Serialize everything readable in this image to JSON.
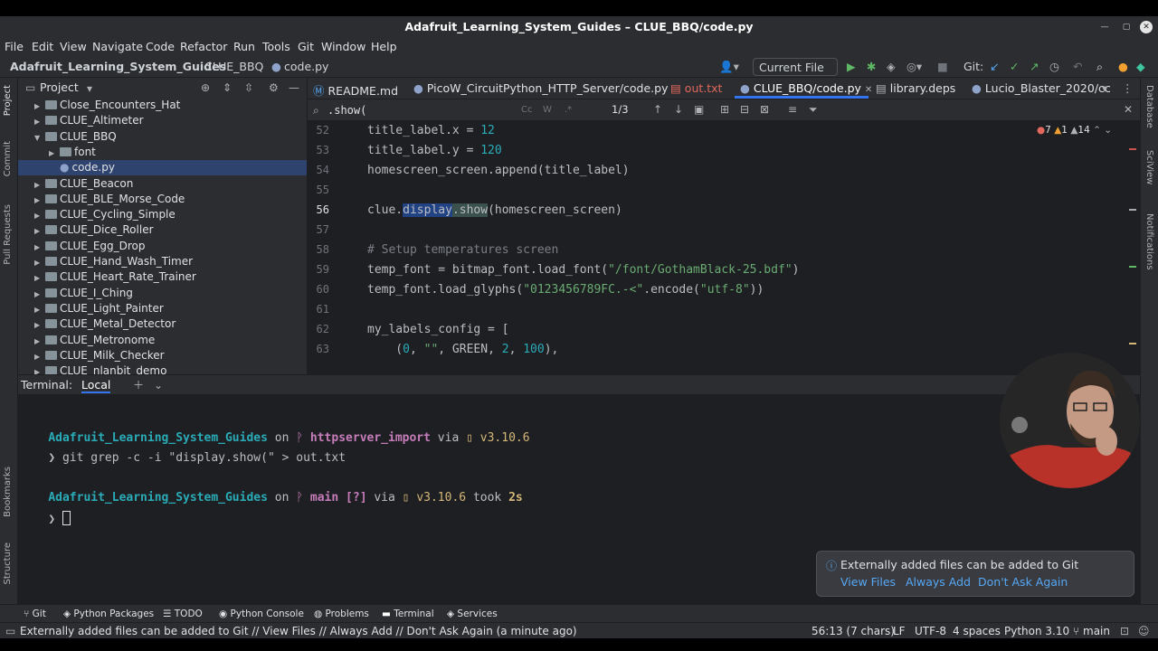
{
  "window": {
    "title": "Adafruit_Learning_System_Guides – CLUE_BBQ/code.py"
  },
  "menu": [
    "File",
    "Edit",
    "View",
    "Navigate",
    "Code",
    "Refactor",
    "Run",
    "Tools",
    "Git",
    "Window",
    "Help"
  ],
  "breadcrumb": [
    "Adafruit_Learning_System_Guides",
    "CLUE_BBQ",
    "code.py"
  ],
  "run_config": "Current File",
  "git_label": "Git:",
  "project": {
    "title": "Project",
    "items": [
      {
        "label": "Close_Encounters_Hat",
        "level": 1,
        "expanded": false
      },
      {
        "label": "CLUE_Altimeter",
        "level": 1,
        "expanded": false
      },
      {
        "label": "CLUE_BBQ",
        "level": 1,
        "expanded": true
      },
      {
        "label": "font",
        "level": 2,
        "expanded": false
      },
      {
        "label": "code.py",
        "level": 2,
        "file": true,
        "selected": true
      },
      {
        "label": "CLUE_Beacon",
        "level": 1,
        "expanded": false
      },
      {
        "label": "CLUE_BLE_Morse_Code",
        "level": 1,
        "expanded": false
      },
      {
        "label": "CLUE_Cycling_Simple",
        "level": 1,
        "expanded": false
      },
      {
        "label": "CLUE_Dice_Roller",
        "level": 1,
        "expanded": false
      },
      {
        "label": "CLUE_Egg_Drop",
        "level": 1,
        "expanded": false
      },
      {
        "label": "CLUE_Hand_Wash_Timer",
        "level": 1,
        "expanded": false
      },
      {
        "label": "CLUE_Heart_Rate_Trainer",
        "level": 1,
        "expanded": false
      },
      {
        "label": "CLUE_I_Ching",
        "level": 1,
        "expanded": false
      },
      {
        "label": "CLUE_Light_Painter",
        "level": 1,
        "expanded": false
      },
      {
        "label": "CLUE_Metal_Detector",
        "level": 1,
        "expanded": false
      },
      {
        "label": "CLUE_Metronome",
        "level": 1,
        "expanded": false
      },
      {
        "label": "CLUE_Milk_Checker",
        "level": 1,
        "expanded": false
      },
      {
        "label": "CLUE_nlanbit_demo",
        "level": 1,
        "expanded": false
      }
    ]
  },
  "tabs": [
    {
      "label": "README.md",
      "active": false
    },
    {
      "label": "PicoW_CircuitPython_HTTP_Server/code.py",
      "active": false
    },
    {
      "label": "out.txt",
      "active": false,
      "color": "#e0685c"
    },
    {
      "label": "CLUE_BBQ/code.py",
      "active": true
    },
    {
      "label": "library.deps",
      "active": false
    },
    {
      "label": "Lucio_Blaster_2020/cc",
      "active": false
    }
  ],
  "find": {
    "query": ".show(",
    "count": "1/3"
  },
  "inspections": {
    "errors": "7",
    "warnings": "1",
    "weak": "14"
  },
  "code_lines": [
    {
      "num": "52",
      "text": "title_label.x = 12"
    },
    {
      "num": "53",
      "text": "title_label.y = 120"
    },
    {
      "num": "54",
      "text": "homescreen_screen.append(title_label)"
    },
    {
      "num": "55",
      "text": ""
    },
    {
      "num": "56",
      "text": "clue.display.show(homescreen_screen)"
    },
    {
      "num": "57",
      "text": ""
    },
    {
      "num": "58",
      "text": "# Setup temperatures screen"
    },
    {
      "num": "59",
      "text": "temp_font = bitmap_font.load_font(\"/font/GothamBlack-25.bdf\")"
    },
    {
      "num": "60",
      "text": "temp_font.load_glyphs(\"0123456789FC.-<\".encode(\"utf-8\"))"
    },
    {
      "num": "61",
      "text": ""
    },
    {
      "num": "62",
      "text": "my_labels_config = ["
    },
    {
      "num": "63",
      "text": "    (0, \"\", GREEN, 2, 100),"
    }
  ],
  "terminal": {
    "label": "Terminal:",
    "tab": "Local",
    "lines": [
      {
        "dir": "Adafruit_Learning_System_Guides",
        "on": "on",
        "branch_icon": "ᚹ",
        "branch": "httpserver_import",
        "via": "via",
        "py": "v3.10.6"
      },
      {
        "prompt": "❯",
        "cmd": "git grep -c -i \"display.show(\" > out.txt"
      },
      {
        "dir": "Adafruit_Learning_System_Guides",
        "on": "on",
        "branch_icon": "ᚹ",
        "branch": "main [?]",
        "via": "via",
        "py": "v3.10.6",
        "took": "took",
        "dur": "2s"
      },
      {
        "prompt": "❯"
      }
    ]
  },
  "tool_windows": [
    "Git",
    "Python Packages",
    "TODO",
    "Python Console",
    "Problems",
    "Terminal",
    "Services"
  ],
  "status": {
    "message": "Externally added files can be added to Git // View Files // Always Add // Don't Ask Again (a minute ago)",
    "position": "56:13 (7 chars)",
    "line_sep": "LF",
    "encoding": "UTF-8",
    "indent": "4 spaces",
    "interpreter": "Python 3.10",
    "branch": "main"
  },
  "notification": {
    "text": "Externally added files can be added to Git",
    "actions": [
      "View Files",
      "Always Add",
      "Don't Ask Again"
    ]
  },
  "side_tools_left": [
    "Project",
    "Commit",
    "Pull Requests",
    "Bookmarks",
    "Structure"
  ],
  "side_tools_right": [
    "Database",
    "SciView",
    "Notifications"
  ]
}
